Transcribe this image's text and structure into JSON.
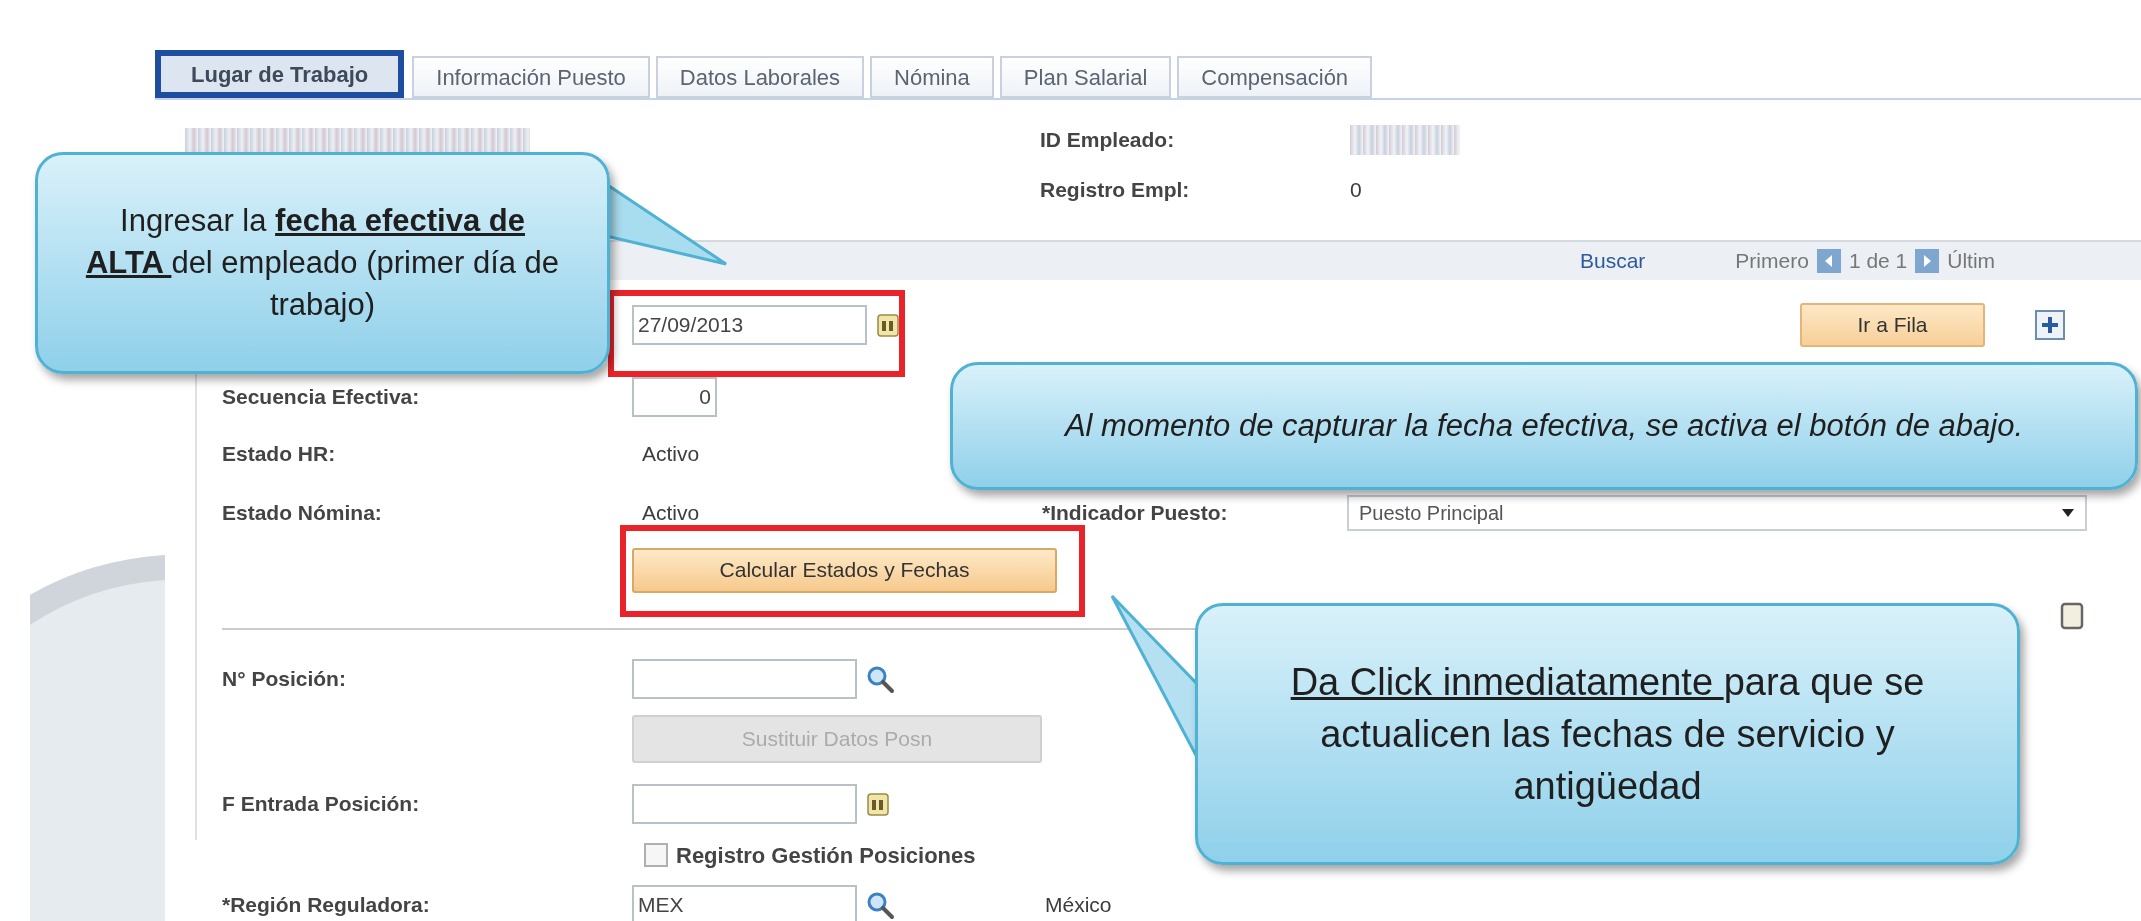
{
  "tabs": [
    {
      "label": "Lugar de Trabajo",
      "selected": true
    },
    {
      "label": "Información Puesto",
      "selected": false
    },
    {
      "label": "Datos Laborales",
      "selected": false
    },
    {
      "label": "Nómina",
      "selected": false
    },
    {
      "label": "Plan Salarial",
      "selected": false
    },
    {
      "label": "Compensación",
      "selected": false
    }
  ],
  "header": {
    "fields": [
      {
        "label": "ID Empleado:"
      },
      {
        "label": "Registro Empl:",
        "value": "0"
      }
    ]
  },
  "nav_bar": {
    "search_link": "Buscar",
    "first": "Primero",
    "counter": "1 de 1",
    "last": "Últim"
  },
  "form": {
    "effective_date": {
      "value": "27/09/2013"
    },
    "go_to_row_button": "Ir a Fila",
    "sequence": {
      "label": "Secuencia Efectiva:",
      "value": "0"
    },
    "hr_status": {
      "label": "Estado HR:",
      "value": "Activo"
    },
    "payroll_status": {
      "label": "Estado Nómina:",
      "value": "Activo"
    },
    "job_indicator": {
      "label": "*Indicador Puesto:",
      "value": "Puesto Principal"
    },
    "calculate_button": "Calcular Estados y Fechas",
    "position_number": {
      "label": "N° Posición:"
    },
    "replace_button": {
      "label": "Sustituir Datos Posn",
      "disabled": true
    },
    "position_entry_date": {
      "label": "F Entrada Posición:"
    },
    "position_checkbox": {
      "label": "Registro Gestión Posiciones",
      "checked": false
    },
    "region": {
      "label": "*Región Reguladora:",
      "value": "MEX",
      "description": "México"
    }
  },
  "callouts": [
    {
      "segments": [
        {
          "text": "Ingresar la ",
          "kind": "plain"
        },
        {
          "text": "fecha efectiva de ALTA ",
          "kind": "emphasis"
        },
        {
          "text": "del empleado (primer día de trabajo)",
          "kind": "plain"
        }
      ]
    },
    {
      "segments": [
        {
          "text": "Al momento de capturar la fecha efectiva, se activa el botón de abajo.",
          "kind": "plain"
        }
      ]
    },
    {
      "segments": [
        {
          "text": "Da Click inmediatamente ",
          "kind": "emphasis"
        },
        {
          "text": "para que se actualicen las fechas de servicio y antigüedad",
          "kind": "plain"
        }
      ]
    }
  ]
}
